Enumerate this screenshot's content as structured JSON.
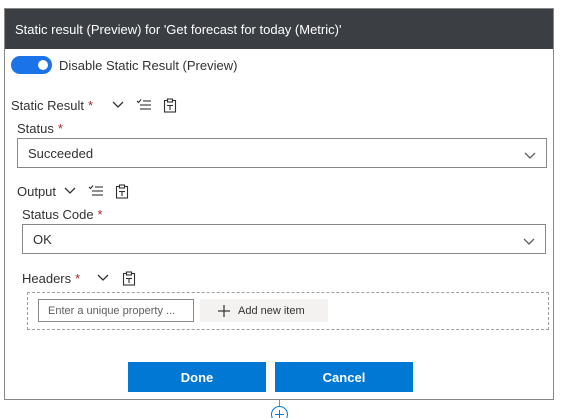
{
  "dialog": {
    "title": "Static result (Preview) for 'Get forecast for today (Metric)'",
    "toggle_label": "Disable Static Result (Preview)",
    "toggle_on": true,
    "accent": "#1a73e8"
  },
  "static_result": {
    "label": "Static Result",
    "required": "*"
  },
  "status": {
    "label": "Status",
    "required": "*",
    "value": "Succeeded"
  },
  "output": {
    "label": "Output"
  },
  "status_code": {
    "label": "Status Code",
    "required": "*",
    "value": "OK"
  },
  "headers": {
    "label": "Headers",
    "required": "*",
    "input_placeholder": "Enter a unique property ...",
    "add_label": "Add new item"
  },
  "footer": {
    "done_label": "Done",
    "cancel_label": "Cancel",
    "button_color": "#0078d4"
  },
  "icons": [
    "chevron-down-icon",
    "list-check-icon",
    "clipboard-icon",
    "plus-icon",
    "add-step-icon"
  ]
}
